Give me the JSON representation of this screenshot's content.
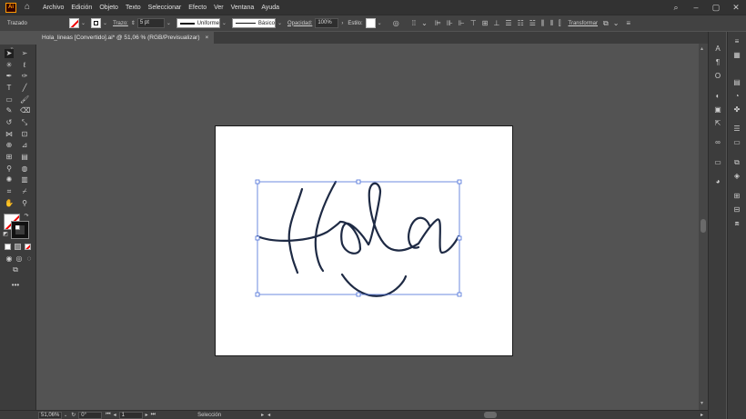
{
  "app": {
    "logo_text": "Ai"
  },
  "menu": [
    "Archivo",
    "Edición",
    "Objeto",
    "Texto",
    "Seleccionar",
    "Efecto",
    "Ver",
    "Ventana",
    "Ayuda"
  ],
  "control": {
    "object_type": "Trazado",
    "stroke_label": "Trazo:",
    "stroke_weight": "5 pt",
    "profile": "Uniforme",
    "brush": "Básico",
    "opacity_label": "Opacidad:",
    "opacity": "100%",
    "style_label": "Estilo:",
    "transform_label": "Transformar"
  },
  "document": {
    "tab_title": "Hola_lineas [Convertido].ai* @ 51,06 % (RGB/Previsualizar)",
    "close": "×"
  },
  "status": {
    "zoom": "51,06%",
    "rotation": "0°",
    "artboard": "1",
    "tool": "Selección"
  },
  "colors": {
    "accent": "#ff9a00",
    "artwork": "#1e2a44",
    "selection": "#4a6fd8"
  }
}
